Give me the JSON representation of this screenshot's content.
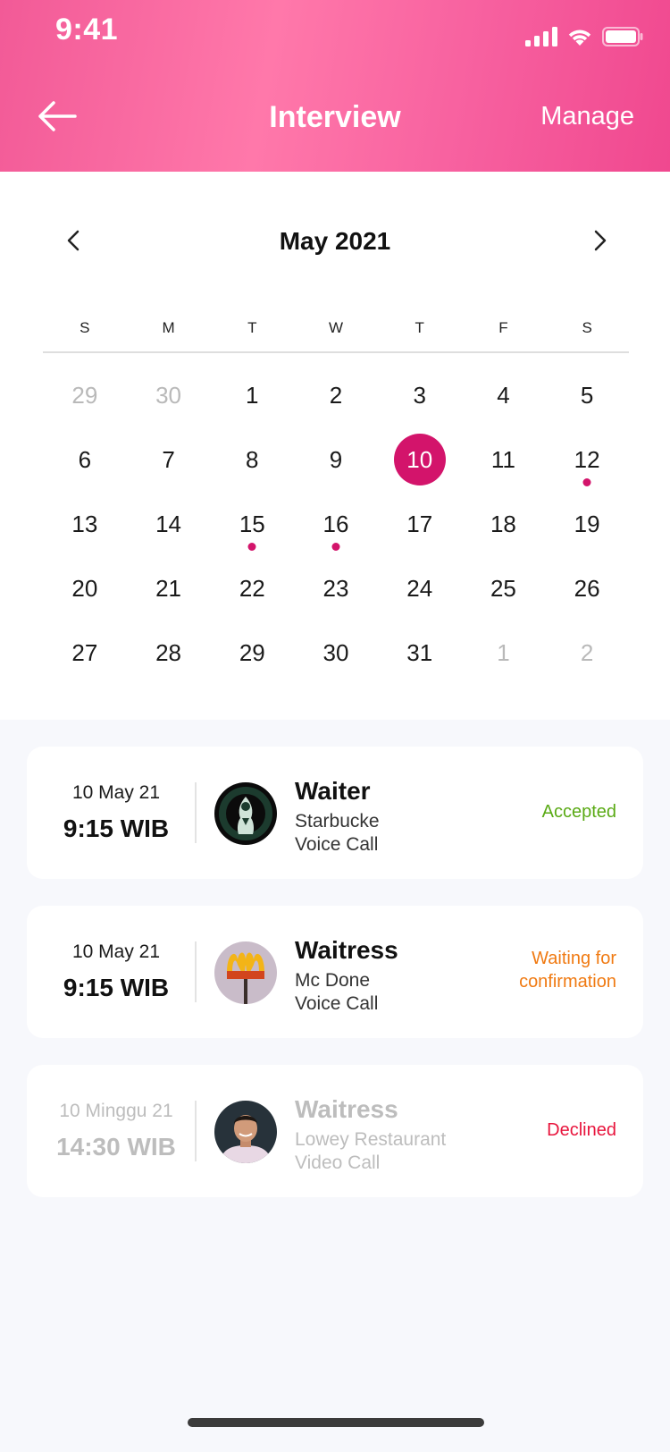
{
  "status_bar": {
    "time": "9:41"
  },
  "header": {
    "title": "Interview",
    "manage_label": "Manage"
  },
  "calendar": {
    "month_label": "May 2021",
    "weekdays": [
      "S",
      "M",
      "T",
      "W",
      "T",
      "F",
      "S"
    ],
    "days": [
      {
        "label": "29",
        "muted": true
      },
      {
        "label": "30",
        "muted": true
      },
      {
        "label": "1"
      },
      {
        "label": "2"
      },
      {
        "label": "3"
      },
      {
        "label": "4"
      },
      {
        "label": "5"
      },
      {
        "label": "6"
      },
      {
        "label": "7"
      },
      {
        "label": "8"
      },
      {
        "label": "9"
      },
      {
        "label": "10",
        "selected": true
      },
      {
        "label": "11"
      },
      {
        "label": "12",
        "event": true
      },
      {
        "label": "13"
      },
      {
        "label": "14"
      },
      {
        "label": "15",
        "event": true
      },
      {
        "label": "16",
        "event": true
      },
      {
        "label": "17"
      },
      {
        "label": "18"
      },
      {
        "label": "19"
      },
      {
        "label": "20"
      },
      {
        "label": "21"
      },
      {
        "label": "22"
      },
      {
        "label": "23"
      },
      {
        "label": "24"
      },
      {
        "label": "25"
      },
      {
        "label": "26"
      },
      {
        "label": "27"
      },
      {
        "label": "28"
      },
      {
        "label": "29"
      },
      {
        "label": "30"
      },
      {
        "label": "31"
      },
      {
        "label": "1",
        "muted": true
      },
      {
        "label": "2",
        "muted": true
      }
    ],
    "accent_color": "#d3146b"
  },
  "interviews": [
    {
      "date": "10 May 21",
      "time": "9:15 WIB",
      "role": "Waiter",
      "company": "Starbucke",
      "call_type": "Voice Call",
      "status": "Accepted",
      "status_color": "#5aaa15",
      "avatar": "starbucks-logo"
    },
    {
      "date": "10 May 21",
      "time": "9:15 WIB",
      "role": "Waitress",
      "company": "Mc Done",
      "call_type": "Voice Call",
      "status_line1": "Waiting for",
      "status_line2": "confirmation",
      "status_color": "#f07a12",
      "avatar": "mcdonalds-sign"
    },
    {
      "date": "10 Minggu 21",
      "time": "14:30 WIB",
      "role": "Waitress",
      "company": "Lowey Restaurant",
      "call_type": "Video Call",
      "status": "Declined",
      "status_color": "#e8143c",
      "avatar": "person-photo"
    }
  ]
}
